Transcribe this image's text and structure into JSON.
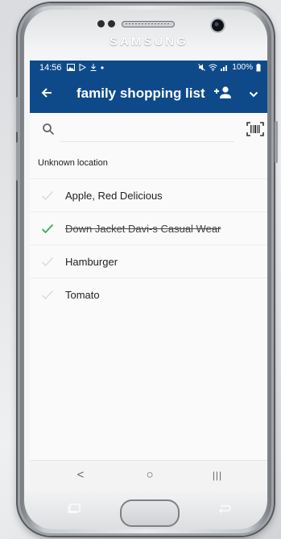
{
  "device": {
    "brand": "SAMSUNG"
  },
  "status_bar": {
    "time": "14:56",
    "left_icons": [
      "gallery-icon",
      "play-store-icon",
      "download-icon",
      "dot-icon"
    ],
    "right_text": "100%",
    "right_icons": [
      "mute-icon",
      "wifi-icon",
      "signal-icon",
      "battery-icon"
    ]
  },
  "app_bar": {
    "title": "family shopping list",
    "back_icon": "arrow-left-icon",
    "share_icon": "add-person-icon",
    "menu_icon": "chevron-down-icon"
  },
  "search": {
    "value": "",
    "placeholder": ""
  },
  "section": {
    "title": "Unknown location"
  },
  "items": [
    {
      "label": "Apple, Red Delicious",
      "checked": false
    },
    {
      "label": "Down Jacket Davi-s Casual Wear",
      "checked": true
    },
    {
      "label": "Hamburger",
      "checked": false
    },
    {
      "label": "Tomato",
      "checked": false
    }
  ],
  "nav_bar": {
    "back": "<",
    "home": "○",
    "recents": "|||"
  },
  "colors": {
    "primary": "#0e4a8a",
    "check_done": "#3aa85a",
    "check_pending": "#dcdcdc"
  }
}
